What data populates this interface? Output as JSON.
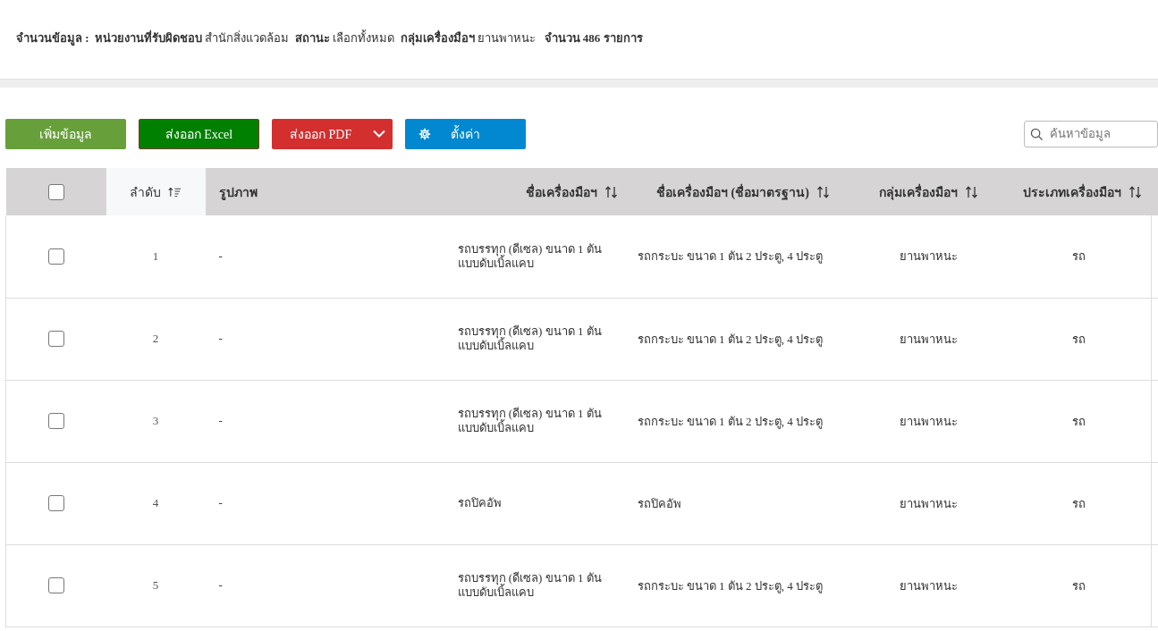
{
  "summary": "**จำนวนข้อมูล :**  **หน่วยงานที่รับผิดชอบ** สำนักสิ่งแวดล้อม  **สถานะ** เลือกทั้งหมด  **กลุ่มเครื่องมือฯ** ยานพาหนะ   **จำนวน 486 รายการ**",
  "toolbar": {
    "buttons": [
      {
        "label": "เพิ่มข้อมูล",
        "kind": "add"
      },
      {
        "label": "ส่งออก Excel",
        "kind": "excel"
      },
      {
        "label": "ส่งออก PDF",
        "kind": "pdf"
      },
      {
        "label": "ตั้งค่า",
        "kind": "settings"
      }
    ],
    "search": {
      "placeholder": "ค้นหาข้อมูล"
    }
  },
  "table": {
    "select_all": {
      "checked": false
    },
    "columns": [
      {
        "label": "ลำดับ",
        "kind": "sorted"
      },
      {
        "label": "รูปภาพ",
        "kind": "plain"
      },
      {
        "label": "ชื่อเครื่องมือฯ",
        "kind": "sortable"
      },
      {
        "label": "ชื่อเครื่องมือฯ (ชื่อมาตรฐาน)",
        "kind": "sortable"
      },
      {
        "label": "กลุ่มเครื่องมือฯ",
        "kind": "sortable"
      },
      {
        "label": "ประเภทเครื่องมือฯ",
        "kind": "sortable"
      }
    ],
    "rows": [
      {
        "checked": false,
        "cells": [
          "1",
          "-",
          "รถบรรทุก (ดีเซล) ขนาด 1 ตัน แบบดับเบิ้ลแคบ",
          "รถกระบะ ขนาด 1 ตัน 2 ประตู, 4 ประตู",
          "ยานพาหนะ",
          "รถ"
        ]
      },
      {
        "checked": false,
        "cells": [
          "2",
          "-",
          "รถบรรทุก (ดีเซล) ขนาด 1 ตัน แบบดับเบิ้ลแคบ",
          "รถกระบะ ขนาด 1 ตัน 2 ประตู, 4 ประตู",
          "ยานพาหนะ",
          "รถ"
        ]
      },
      {
        "checked": false,
        "cells": [
          "3",
          "-",
          "รถบรรทุก (ดีเซล) ขนาด 1 ตัน แบบดับเบิ้ลแคบ",
          "รถกระบะ ขนาด 1 ตัน 2 ประตู, 4 ประตู",
          "ยานพาหนะ",
          "รถ"
        ]
      },
      {
        "checked": false,
        "cells": [
          "4",
          "-",
          "รถปิคอัพ",
          "รถปิคอัพ",
          "ยานพาหนะ",
          "รถ"
        ]
      },
      {
        "checked": false,
        "cells": [
          "5",
          "-",
          "รถบรรทุก (ดีเซล) ขนาด 1 ตัน แบบดับเบิ้ลแคบ",
          "รถกระบะ ขนาด 1 ตัน 2 ประตู, 4 ประตู",
          "ยานพาหนะ",
          "รถ"
        ]
      }
    ]
  }
}
